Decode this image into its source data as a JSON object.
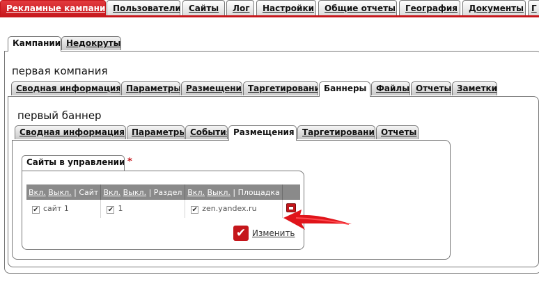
{
  "topnav": {
    "tabs": [
      {
        "label": "Рекламные кампании",
        "active": true
      },
      {
        "label": "Пользователи"
      },
      {
        "label": "Сайты"
      },
      {
        "label": "Лог"
      },
      {
        "label": "Настройки"
      },
      {
        "label": "Общие отчеты"
      },
      {
        "label": "География"
      },
      {
        "label": "Документы"
      },
      {
        "label": "Г"
      }
    ]
  },
  "level1": {
    "tabs": [
      {
        "label": "Кампании",
        "active": true
      },
      {
        "label": "Недокруты"
      }
    ]
  },
  "campaign": {
    "title": "первая компания",
    "tabs": [
      {
        "label": "Сводная информация"
      },
      {
        "label": "Параметры"
      },
      {
        "label": "Размещение"
      },
      {
        "label": "Таргетирование"
      },
      {
        "label": "Баннеры",
        "active": true
      },
      {
        "label": "Файлы"
      },
      {
        "label": "Отчеты"
      },
      {
        "label": "Заметки"
      }
    ]
  },
  "banner": {
    "title": "первый баннер",
    "tabs": [
      {
        "label": "Сводная информация"
      },
      {
        "label": "Параметры"
      },
      {
        "label": "События"
      },
      {
        "label": "Размещения",
        "active": true
      },
      {
        "label": "Таргетирование"
      },
      {
        "label": "Отчеты"
      }
    ]
  },
  "placements": {
    "tab_label": "Сайты в управлении",
    "marker": "*",
    "headers": [
      {
        "on": "Вкл.",
        "off": "Выкл.",
        "sep": "|",
        "name": "Сайт"
      },
      {
        "on": "Вкл.",
        "off": "Выкл.",
        "sep": "|",
        "name": "Раздел"
      },
      {
        "on": "Вкл.",
        "off": "Выкл.",
        "sep": "|",
        "name": "Площадка"
      }
    ],
    "row": {
      "site": "сайт 1",
      "section": "1",
      "place": "zen.yandex.ru"
    },
    "change_label": "Изменить",
    "check_glyph": "✔"
  },
  "colors": {
    "accent": "#c5161b",
    "header_gray": "#8a8a8a"
  }
}
